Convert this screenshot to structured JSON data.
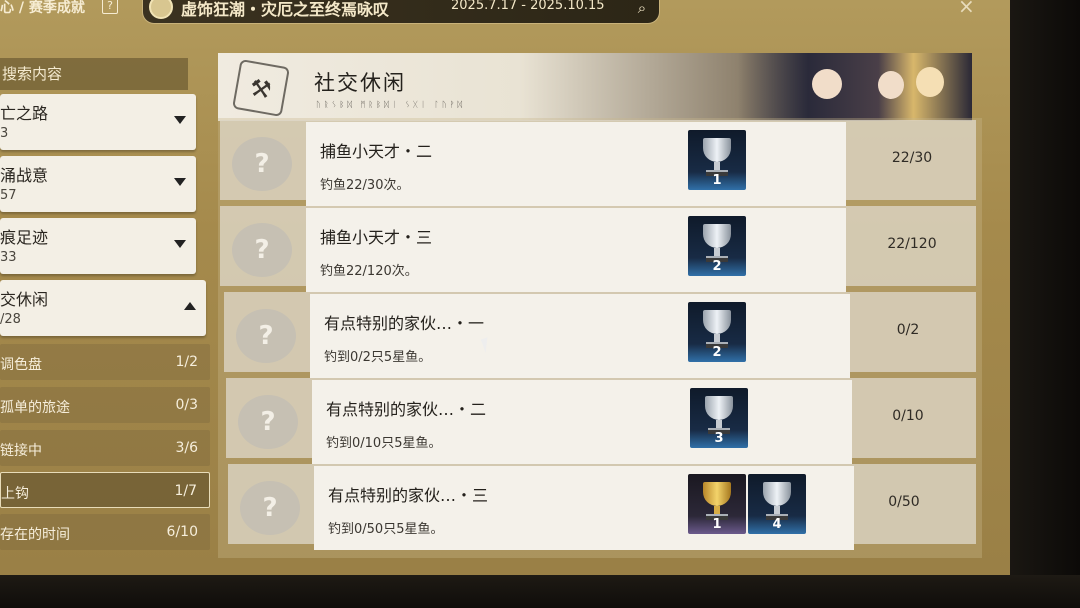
{
  "topbar": {
    "breadcrumb": "心 / 赛季成就",
    "help": "?",
    "event_title": "虚饰狂潮・灾厄之至终焉咏叹",
    "event_date": "2025.7.17 - 2025.10.15",
    "search_icon": "search-icon",
    "close": "×"
  },
  "sidebar": {
    "header": "搜索内容",
    "categories": [
      {
        "name": "亡之路",
        "count": "3",
        "expanded": false
      },
      {
        "name": "涌战意",
        "count": "57",
        "expanded": false
      },
      {
        "name": "痕足迹",
        "count": "33",
        "expanded": false
      },
      {
        "name": "交休闲",
        "count": "/28",
        "expanded": true
      }
    ],
    "subitems": [
      {
        "name": "调色盘",
        "count": "1/2"
      },
      {
        "name": "孤单的旅途",
        "count": "0/3"
      },
      {
        "name": "链接中",
        "count": "3/6"
      },
      {
        "name": "上钩",
        "count": "1/7",
        "selected": true
      },
      {
        "name": "存在的时间",
        "count": "6/10"
      }
    ]
  },
  "panel": {
    "title": "社交休闲",
    "subtitle": "ᚢᚱᛊᛒᛞ ᛗᚱᛒᛞᛁ ᛊᚷᛁ ᛚᚢᚹᛞ"
  },
  "achievements": [
    {
      "badge": "?",
      "title": "捕鱼小天才・二",
      "desc": "钓鱼22/30次。",
      "trophies": [
        {
          "tier": "silver",
          "num": "1"
        }
      ],
      "progress": "22/30"
    },
    {
      "badge": "?",
      "title": "捕鱼小天才・三",
      "desc": "钓鱼22/120次。",
      "trophies": [
        {
          "tier": "silver",
          "num": "2"
        }
      ],
      "progress": "22/120"
    },
    {
      "badge": "?",
      "title": "有点特别的家伙…・一",
      "desc": "钓到0/2只5星鱼。",
      "trophies": [
        {
          "tier": "silver",
          "num": "2"
        }
      ],
      "progress": "0/2"
    },
    {
      "badge": "?",
      "title": "有点特别的家伙…・二",
      "desc": "钓到0/10只5星鱼。",
      "trophies": [
        {
          "tier": "silver",
          "num": "3"
        }
      ],
      "progress": "0/10"
    },
    {
      "badge": "?",
      "title": "有点特别的家伙…・三",
      "desc": "钓到0/50只5星鱼。",
      "trophies": [
        {
          "tier": "gold",
          "num": "1"
        },
        {
          "tier": "silver",
          "num": "4"
        }
      ],
      "progress": "0/50"
    }
  ]
}
